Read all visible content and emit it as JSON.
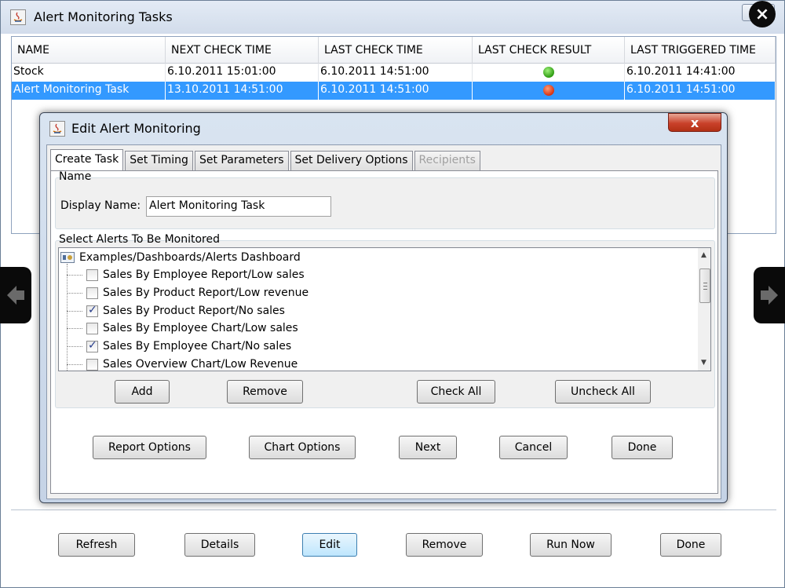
{
  "window": {
    "title": "Alert Monitoring Tasks"
  },
  "table": {
    "columns": [
      "NAME",
      "NEXT CHECK TIME",
      "LAST CHECK TIME",
      "LAST CHECK RESULT",
      "LAST TRIGGERED TIME"
    ],
    "rows": [
      {
        "name": "Stock",
        "next": "6.10.2011 15:01:00",
        "last": "6.10.2011 14:51:00",
        "result": "green",
        "triggered": "6.10.2011 14:41:00"
      },
      {
        "name": "Alert Monitoring Task",
        "next": "13.10.2011 14:51:00",
        "last": "6.10.2011 14:51:00",
        "result": "red",
        "triggered": "6.10.2011 14:51:00"
      }
    ]
  },
  "bottom_buttons": {
    "refresh": "Refresh",
    "details": "Details",
    "edit": "Edit",
    "remove": "Remove",
    "run_now": "Run Now",
    "done": "Done"
  },
  "dialog": {
    "title": "Edit Alert Monitoring",
    "close": "x",
    "tabs": [
      "Create Task",
      "Set Timing",
      "Set Parameters",
      "Set Delivery Options",
      "Recipients"
    ],
    "name_group": {
      "label": "Name",
      "display_name_label": "Display Name:",
      "display_name_value": "Alert Monitoring Task"
    },
    "alerts_group": {
      "label": "Select Alerts To Be Monitored",
      "root": "Examples/Dashboards/Alerts Dashboard",
      "items": [
        {
          "label": "Sales By Employee Report/Low sales",
          "checked": false
        },
        {
          "label": "Sales By Product Report/Low revenue",
          "checked": false
        },
        {
          "label": "Sales By Product Report/No sales",
          "checked": true
        },
        {
          "label": "Sales By Employee Chart/Low sales",
          "checked": false
        },
        {
          "label": "Sales By Employee Chart/No sales",
          "checked": true
        },
        {
          "label": "Sales Overview Chart/Low Revenue",
          "checked": false
        }
      ],
      "add": "Add",
      "remove": "Remove",
      "check_all": "Check All",
      "uncheck_all": "Uncheck All"
    },
    "footer_buttons": {
      "report_options": "Report Options",
      "chart_options": "Chart Options",
      "next": "Next",
      "cancel": "Cancel",
      "done": "Done"
    }
  },
  "colors": {
    "selection": "#3399ff",
    "ok": "#2e9b12",
    "fail": "#d83212"
  }
}
